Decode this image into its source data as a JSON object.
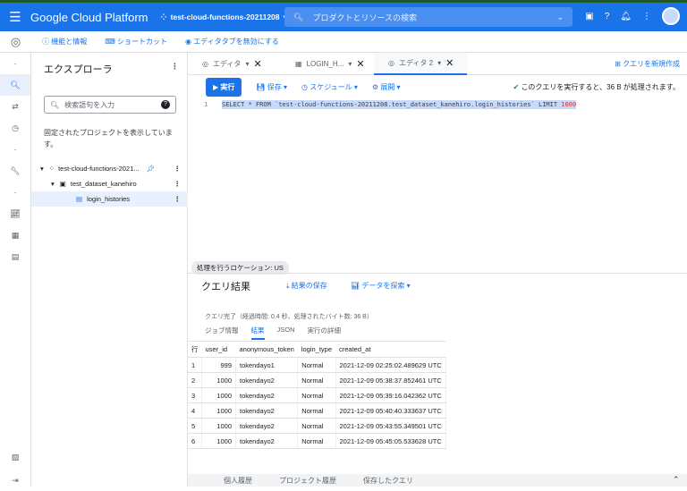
{
  "header": {
    "brand": "Google Cloud Platform",
    "project": "test-cloud-functions-20211208",
    "search_placeholder": "プロダクトとリソースの検索"
  },
  "toolbar": {
    "items": [
      "機能と情報",
      "ショートカット",
      "エディタタブを無効にする"
    ]
  },
  "explorer": {
    "title": "エクスプローラ",
    "search_placeholder": "検索語句を入力",
    "pinned_text": "固定されたプロジェクトを表示しています。",
    "tree": {
      "project": "test-cloud-functions-2021...",
      "dataset": "test_dataset_kanehiro",
      "table": "login_histories"
    }
  },
  "tabs": [
    {
      "label": "エディタ"
    },
    {
      "label": "LOGIN_H..."
    },
    {
      "label": "エディタ 2"
    }
  ],
  "new_query": "クエリを新規作成",
  "actions": {
    "run": "実行",
    "save": "保存",
    "schedule": "スケジュール",
    "deploy": "展開",
    "status": "このクエリを実行すると、36 B が処理されます。"
  },
  "editor": {
    "line": "1",
    "sql": "SELECT * FROM `test-cloud-functions-20211208.test_dataset_kanehiro.login_histories` LIMIT ",
    "limit": "1000"
  },
  "location": "処理を行うロケーション: US",
  "results": {
    "title": "クエリ結果",
    "save": "結果の保存",
    "explore": "データを探索",
    "info": "クエリ完了（経過時間: 0.4 秒、処理されたバイト数: 36 B）",
    "tabs": [
      "ジョブ情報",
      "結果",
      "JSON",
      "実行の詳細"
    ],
    "columns": [
      "行",
      "user_id",
      "anonymous_token",
      "login_type",
      "created_at"
    ],
    "rows": [
      [
        "1",
        "999",
        "tokendayo1",
        "Normal",
        "2021-12-09 02:25:02.489629 UTC"
      ],
      [
        "2",
        "1000",
        "tokendayo2",
        "Normal",
        "2021-12-09 05:38:37.852461 UTC"
      ],
      [
        "3",
        "1000",
        "tokendayo2",
        "Normal",
        "2021-12-09 05:39:16.042362 UTC"
      ],
      [
        "4",
        "1000",
        "tokendayo2",
        "Normal",
        "2021-12-09 05:40:40.333637 UTC"
      ],
      [
        "5",
        "1000",
        "tokendayo2",
        "Normal",
        "2021-12-09 05:43:55.349501 UTC"
      ],
      [
        "6",
        "1000",
        "tokendayo2",
        "Normal",
        "2021-12-09 05:45:05.533628 UTC"
      ]
    ]
  },
  "bottom_tabs": [
    "個人履歴",
    "プロジェクト履歴",
    "保存したクエリ"
  ]
}
